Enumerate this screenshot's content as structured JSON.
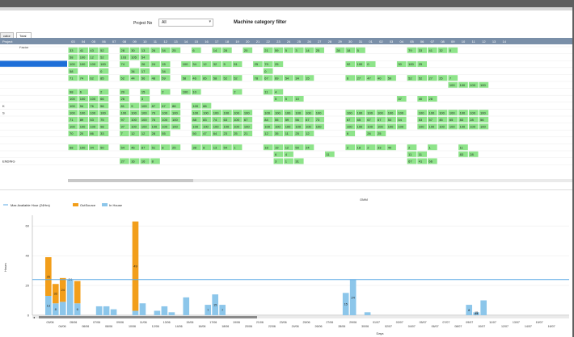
{
  "filters": {
    "project_label": "Project No",
    "project_value": "All",
    "title": "Machine category filter"
  },
  "tabs": [
    {
      "label": "cator"
    },
    {
      "label": "Total Load Factor"
    }
  ],
  "grid": {
    "first_header": "Project",
    "columns": [
      "03",
      "04",
      "05",
      "06",
      "07",
      "08",
      "09",
      "10",
      "11",
      "12",
      "13",
      "14",
      "15",
      "16",
      "17",
      "18",
      "19",
      "20",
      "21",
      "22",
      "23",
      "24",
      "25",
      "26",
      "27",
      "28",
      "29",
      "30",
      "31",
      "01",
      "02",
      "03",
      "04",
      "05",
      "06",
      "07",
      "08",
      "09",
      "10",
      "11",
      "12",
      "13",
      "14"
    ],
    "row_labels": [
      "",
      "",
      "",
      "",
      "",
      "",
      "",
      "",
      "K",
      "S",
      "",
      "",
      "",
      "",
      "",
      "",
      "ENDING",
      "",
      ""
    ],
    "rows": [
      [
        "33",
        "41",
        "43",
        "52",
        "",
        "28",
        "30",
        "13",
        "26",
        "34",
        "25",
        "",
        "6",
        "",
        "14",
        "28",
        "",
        "20",
        "",
        "21",
        "59",
        "5",
        "3",
        "14",
        "25",
        "",
        "28",
        "18",
        "5",
        "",
        "",
        "",
        "",
        "79",
        "33",
        "41",
        "32",
        "0",
        "",
        "",
        ""
      ],
      [
        "58",
        "100",
        "12",
        "52",
        "",
        "103",
        "105",
        "54",
        "",
        "",
        "",
        "",
        "",
        "",
        "",
        "",
        "",
        "",
        "",
        "",
        "",
        "",
        "",
        "",
        "",
        "",
        "",
        "",
        "",
        "",
        "",
        "",
        "",
        "",
        "",
        "",
        "",
        "",
        "",
        "",
        ""
      ],
      [
        "100",
        "100",
        "100",
        "100",
        "",
        "74",
        "",
        "26",
        "24",
        "15",
        "",
        "100",
        "34",
        "12",
        "32",
        "5",
        "51",
        "",
        "25",
        "79",
        "25",
        "",
        "",
        "",
        "",
        "",
        "",
        "92",
        "100",
        "0",
        "",
        "",
        "30",
        "100",
        "25",
        "",
        "",
        "",
        "",
        "",
        ""
      ],
      [
        "58",
        "",
        "",
        "0",
        "",
        "",
        "34",
        "17",
        "",
        "34",
        "",
        "",
        "",
        "",
        "",
        "",
        "",
        "",
        "",
        "0",
        "",
        "",
        "",
        "",
        "",
        "",
        "",
        "",
        "",
        "",
        "",
        "",
        "",
        "",
        "",
        "",
        "",
        "",
        "",
        "",
        ""
      ],
      [
        "71",
        "74",
        "62",
        "85",
        "",
        "52",
        "44",
        "56",
        "48",
        "59",
        "",
        "58",
        "46",
        "85",
        "58",
        "52",
        "52",
        "",
        "78",
        "67",
        "69",
        "54",
        "34",
        "15",
        "",
        "",
        "",
        "6",
        "27",
        "47",
        "40",
        "59",
        "",
        "52",
        "52",
        "27",
        "25",
        "7",
        "",
        "",
        ""
      ],
      [
        "",
        "",
        "",
        "",
        "",
        "",
        "",
        "",
        "",
        "",
        "",
        "",
        "",
        "",
        "",
        "",
        "",
        "",
        "",
        "",
        "",
        "",
        "",
        "",
        "",
        "",
        "",
        "",
        "",
        "",
        "",
        "",
        "",
        "",
        "",
        "",
        "",
        "100",
        "100",
        "100",
        "100"
      ],
      [
        "98",
        "6",
        "",
        "2",
        "",
        "20",
        "",
        "15",
        "",
        "2",
        "",
        "100",
        "10",
        "",
        "",
        "",
        "2",
        "",
        "",
        "11",
        "4",
        "",
        "",
        "",
        "",
        "",
        "",
        "",
        "",
        "",
        "",
        "",
        "",
        "",
        "",
        "",
        "",
        "",
        "",
        "",
        ""
      ],
      [
        "100",
        "100",
        "100",
        "66",
        "",
        "26",
        "",
        "3",
        "",
        "",
        "",
        "",
        "",
        "",
        "",
        "",
        "",
        "",
        "",
        "",
        "5",
        "5",
        "10",
        "",
        "",
        "",
        "",
        "",
        "",
        "",
        "",
        "",
        "37",
        "",
        "40",
        "28",
        "",
        "",
        "",
        "",
        ""
      ],
      [
        "100",
        "94",
        "76",
        "56",
        "",
        "81",
        "9",
        "100",
        "87",
        "67",
        "88",
        "",
        "100",
        "88",
        "",
        "",
        "",
        "",
        "",
        "",
        "",
        "",
        "",
        "",
        "",
        "",
        "",
        "",
        "",
        "",
        "",
        "",
        "",
        "",
        "",
        "",
        "",
        "",
        "",
        "",
        ""
      ],
      [
        "100",
        "100",
        "100",
        "100",
        "",
        "100",
        "100",
        "100",
        "79",
        "100",
        "100",
        "",
        "100",
        "100",
        "100",
        "100",
        "100",
        "100",
        "",
        "100",
        "100",
        "100",
        "100",
        "100",
        "100",
        "",
        "",
        "100",
        "100",
        "100",
        "100",
        "100",
        "100",
        "",
        "100",
        "100",
        "100",
        "100",
        "100",
        "100",
        "100"
      ],
      [
        "71",
        "89",
        "53",
        "75",
        "",
        "97",
        "100",
        "100",
        "76",
        "100",
        "100",
        "",
        "88",
        "83",
        "74",
        "63",
        "100",
        "67",
        "",
        "84",
        "55",
        "59",
        "56",
        "67",
        "73",
        "",
        "",
        "67",
        "65",
        "67",
        "67",
        "53",
        "54",
        "",
        "53",
        "57",
        "45",
        "65",
        "83",
        "28",
        "56"
      ],
      [
        "100",
        "100",
        "100",
        "98",
        "",
        "97",
        "100",
        "100",
        "100",
        "100",
        "100",
        "",
        "100",
        "100",
        "100",
        "100",
        "100",
        "100",
        "",
        "100",
        "100",
        "100",
        "100",
        "100",
        "100",
        "",
        "",
        "100",
        "100",
        "100",
        "100",
        "100",
        "100",
        "",
        "100",
        "100",
        "100",
        "100",
        "100",
        "100",
        "100"
      ],
      [
        "70",
        "20",
        "86",
        "33",
        "",
        "7",
        "12",
        "12",
        "28",
        "55",
        "",
        "",
        "50",
        "47",
        "64",
        "23",
        "25",
        "21",
        "",
        "12",
        "35",
        "11",
        "25",
        "12",
        "",
        "",
        "",
        "6",
        "",
        "26",
        "25",
        "",
        "",
        "",
        "",
        "",
        "",
        "",
        "",
        "",
        ""
      ],
      [
        "",
        "",
        "",
        "",
        "",
        "",
        "",
        "",
        "",
        "",
        "",
        "",
        "",
        "",
        "",
        "",
        "",
        "",
        "",
        "",
        "",
        "",
        "",
        "",
        "",
        "",
        "",
        "",
        "",
        "",
        "",
        "",
        "",
        "",
        "",
        "",
        "",
        "",
        "",
        "",
        ""
      ],
      [
        "68",
        "100",
        "94",
        "50",
        "",
        "54",
        "46",
        "87",
        "51",
        "8",
        "25",
        "",
        "38",
        "8",
        "13",
        "54",
        "1",
        "",
        "",
        "18",
        "19",
        "12",
        "50",
        "24",
        "",
        "",
        "",
        "2",
        "18",
        "2",
        "33",
        "40",
        "",
        "2",
        "",
        "1",
        "",
        "",
        "11",
        "",
        ""
      ],
      [
        "",
        "",
        "",
        "",
        "",
        "",
        "",
        "",
        "",
        "",
        "",
        "",
        "",
        "",
        "",
        "",
        "",
        "",
        "",
        "",
        "6",
        "4",
        "",
        "",
        "",
        "11",
        "",
        "",
        "",
        "",
        "",
        "",
        "",
        "11",
        "11",
        "",
        "",
        "",
        "83",
        "28",
        ""
      ],
      [
        "",
        "",
        "",
        "",
        "",
        "27",
        "16",
        "16",
        "8",
        "",
        "",
        "",
        "",
        "",
        "",
        "",
        "",
        "",
        "",
        "",
        "3",
        "1",
        "31",
        "",
        "",
        "",
        "",
        "",
        "",
        "",
        "",
        "",
        "",
        "67",
        "41",
        "66",
        "",
        "",
        "",
        "",
        ""
      ]
    ]
  },
  "chart": {
    "top_label": "OMM",
    "legend": [
      "Max Available Hour (24Hrs)",
      "OutSource",
      "In House"
    ],
    "y_axis_label": "Hours",
    "x_axis_label": "Days",
    "date_labels_top": [
      "03/06",
      "05/06",
      "07/06",
      "09/06",
      "11/06",
      "13/06",
      "15/06",
      "17/06",
      "19/06",
      "21/06",
      "23/06",
      "25/06",
      "27/06",
      "29/06",
      "01/07",
      "03/07",
      "05/07",
      "07/07",
      "09/07",
      "11/07",
      "13/07",
      "15/07"
    ],
    "date_labels_bottom": [
      "04/06",
      "06/06",
      "08/06",
      "10/06",
      "12/06",
      "14/06",
      "16/06",
      "18/06",
      "20/06",
      "22/06",
      "24/06",
      "26/06",
      "28/06",
      "30/06",
      "02/07",
      "04/07",
      "06/07",
      "08/07",
      "10/07",
      "12/07",
      "14/07",
      "16/07"
    ],
    "colors": {
      "outsource": "#f29e1a",
      "inhouse": "#8cc6ea",
      "maxline": "#5aa9e6",
      "green": "#8ee48a"
    }
  },
  "chart_data": {
    "type": "bar",
    "y_ticks": [
      0,
      20,
      40,
      60
    ],
    "ylim": [
      0,
      65
    ],
    "max_line": 24,
    "series": [
      {
        "name": "OutSource",
        "values": [
          26,
          13,
          16,
          0,
          15,
          0,
          0,
          0,
          0,
          0,
          0,
          0,
          60,
          0,
          0,
          0,
          0,
          0,
          0,
          0,
          0,
          0,
          0,
          0,
          0,
          0,
          0,
          0,
          0,
          0,
          0,
          0,
          0,
          0,
          0,
          0,
          0,
          0,
          0,
          0,
          0,
          0,
          0,
          0,
          0,
          0,
          0,
          0,
          0,
          0,
          0,
          0,
          0,
          0,
          0,
          0,
          0,
          0,
          0,
          0,
          0,
          0,
          0,
          0,
          0,
          0,
          0,
          0,
          0,
          0,
          0,
          0
        ]
      },
      {
        "name": "In House",
        "values": [
          13,
          8,
          9,
          24,
          8,
          0,
          0,
          6,
          6,
          4,
          0,
          0,
          3,
          8,
          0,
          3,
          6,
          2,
          0,
          12,
          0,
          0,
          7,
          14,
          7,
          0,
          0,
          0,
          0,
          0,
          0,
          0,
          0,
          0,
          0,
          0,
          0,
          0,
          0,
          0,
          0,
          15,
          24,
          0,
          2,
          0,
          0,
          0,
          0,
          0,
          0,
          0,
          0,
          0,
          0,
          0,
          0,
          0,
          7,
          2,
          10,
          0,
          0,
          0,
          0,
          0,
          0,
          0,
          0,
          0,
          0,
          0
        ]
      }
    ],
    "bar_labels": [
      {
        "i": 0,
        "out": "26",
        "in": "13"
      },
      {
        "i": 1,
        "out": "32",
        "in": "8"
      },
      {
        "i": 2,
        "out": "24"
      },
      {
        "i": 3,
        "out": "24"
      },
      {
        "i": 4,
        "out": "",
        "in": "6"
      },
      {
        "i": 12,
        "out": "49"
      },
      {
        "i": 22,
        "in": "7"
      },
      {
        "i": 23,
        "in": "15"
      },
      {
        "i": 24,
        "in": "7"
      },
      {
        "i": 41,
        "in": "15"
      },
      {
        "i": 42,
        "in": "24"
      },
      {
        "i": 58,
        "in": "8"
      },
      {
        "i": 59,
        "out": "15",
        "in": "24"
      }
    ]
  }
}
